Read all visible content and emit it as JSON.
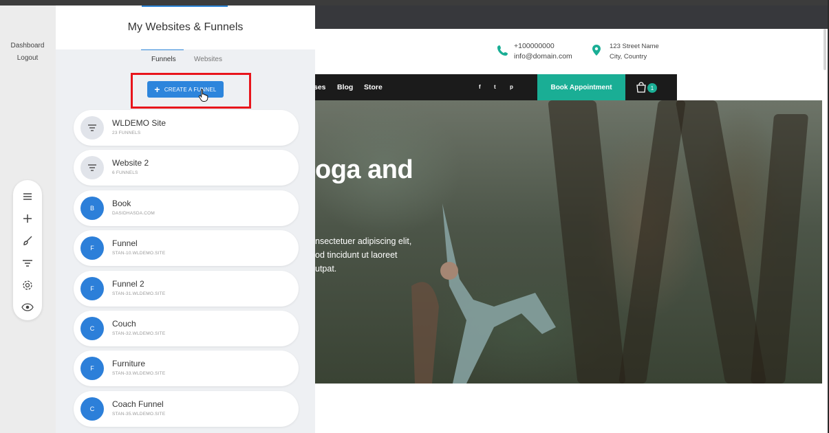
{
  "left_nav": {
    "dashboard": "Dashboard",
    "logout": "Logout"
  },
  "tool_rail": [
    "menu-icon",
    "plus-icon",
    "brush-icon",
    "filter-icon",
    "gear-icon",
    "eye-icon"
  ],
  "panel": {
    "title": "My Websites & Funnels",
    "tabs": [
      {
        "label": "Funnels",
        "active": true
      },
      {
        "label": "Websites",
        "active": false
      }
    ],
    "create_button": "CREATE A FUNNEL",
    "items": [
      {
        "name": "WLDEMO Site",
        "sub": "23 FUNNELS",
        "avatar": "",
        "avatar_type": "filter-icon"
      },
      {
        "name": "Website 2",
        "sub": "6 FUNNELS",
        "avatar": "",
        "avatar_type": "filter-icon"
      },
      {
        "name": "Book",
        "sub": "DASIDHASDA.COM",
        "avatar": "B",
        "avatar_type": "letter"
      },
      {
        "name": "Funnel",
        "sub": "STAN-10.WLDEMO.SITE",
        "avatar": "F",
        "avatar_type": "letter"
      },
      {
        "name": "Funnel 2",
        "sub": "STAN-31.WLDEMO.SITE",
        "avatar": "F",
        "avatar_type": "letter"
      },
      {
        "name": "Couch",
        "sub": "STAN-32.WLDEMO.SITE",
        "avatar": "C",
        "avatar_type": "letter"
      },
      {
        "name": "Furniture",
        "sub": "STAN-33.WLDEMO.SITE",
        "avatar": "F",
        "avatar_type": "letter"
      },
      {
        "name": "Coach Funnel",
        "sub": "STAN-35.WLDEMO.SITE",
        "avatar": "C",
        "avatar_type": "letter"
      }
    ]
  },
  "site": {
    "phone": "+100000000",
    "email": "info@domain.com",
    "address_line1": "123 Street Name",
    "address_line2": "City, Country",
    "nav": {
      "partial": "ses",
      "blog": "Blog",
      "store": "Store"
    },
    "social": [
      "f",
      "t",
      "p"
    ],
    "book_button": "Book Appointment",
    "cart_count": "1",
    "hero_title": "oga and",
    "hero_text_1": "nsectetuer adipiscing elit,",
    "hero_text_2": "od tincidunt ut laoreet",
    "hero_text_3": "utpat.",
    "accent_color": "#1aae95"
  }
}
